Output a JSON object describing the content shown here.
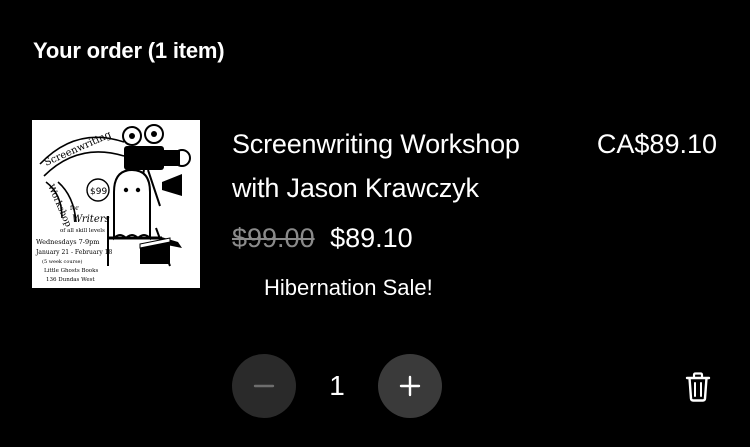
{
  "order": {
    "heading": "Your order (1 item)"
  },
  "item": {
    "image_icon": "screenwriting-workshop-poster",
    "title": "Screenwriting Workshop with Jason Krawczyk",
    "line_total": "CA$89.10",
    "original_price": "$99.00",
    "sale_price": "$89.10",
    "promotion": "Hibernation Sale!",
    "quantity": "1",
    "poster_text": {
      "banner_line1": "Screenwriting",
      "banner_line2": "Workshop",
      "price_tag": "$99",
      "for": "for",
      "audience": "Writers",
      "skill": "of all skill levels",
      "days": "Wednesdays 7-9pm",
      "dates": "January 21 - February 18",
      "weeks": "(5 week course)",
      "venue1": "Little Ghosts Books",
      "venue2": "136 Dundas West"
    }
  },
  "controls": {
    "decrease_icon": "minus-icon",
    "increase_icon": "plus-icon",
    "remove_icon": "trash-icon"
  },
  "colors": {
    "background": "#000000",
    "text": "#ffffff",
    "muted": "#8a8a8a",
    "minus_button": "#2a2a2a",
    "plus_button": "#3a3a3a"
  }
}
